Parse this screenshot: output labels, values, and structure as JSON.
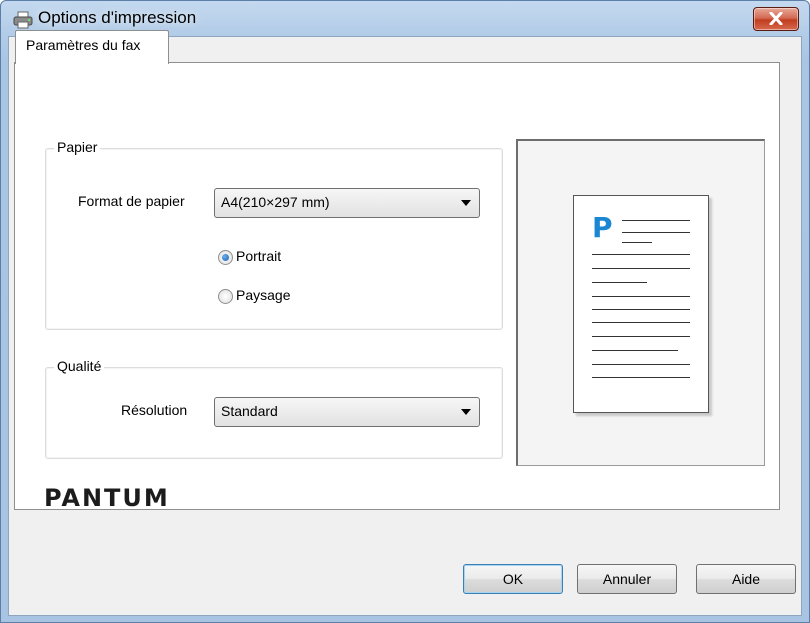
{
  "window": {
    "title": "Options d'impression"
  },
  "tabs": [
    {
      "label": "Paramètres du fax",
      "selected": true
    }
  ],
  "paper_group": {
    "title": "Papier",
    "format_label": "Format de papier",
    "format_value": "A4(210×297 mm)",
    "orientation": [
      {
        "label": "Portrait",
        "checked": true
      },
      {
        "label": "Paysage",
        "checked": false
      }
    ]
  },
  "quality_group": {
    "title": "Qualité",
    "resolution_label": "Résolution",
    "resolution_value": "Standard"
  },
  "preview": {
    "page_letter": "P"
  },
  "brand": {
    "logo_text": "PANTUM"
  },
  "buttons": {
    "ok": "OK",
    "cancel": "Annuler",
    "help": "Aide"
  },
  "colors": {
    "accent_blue": "#1b86d2",
    "close_red": "#c23d20",
    "titlebar": "#b4cde8"
  },
  "icons": {
    "title": "printer-icon",
    "close": "close-icon",
    "dropdown": "chevron-down-icon"
  }
}
